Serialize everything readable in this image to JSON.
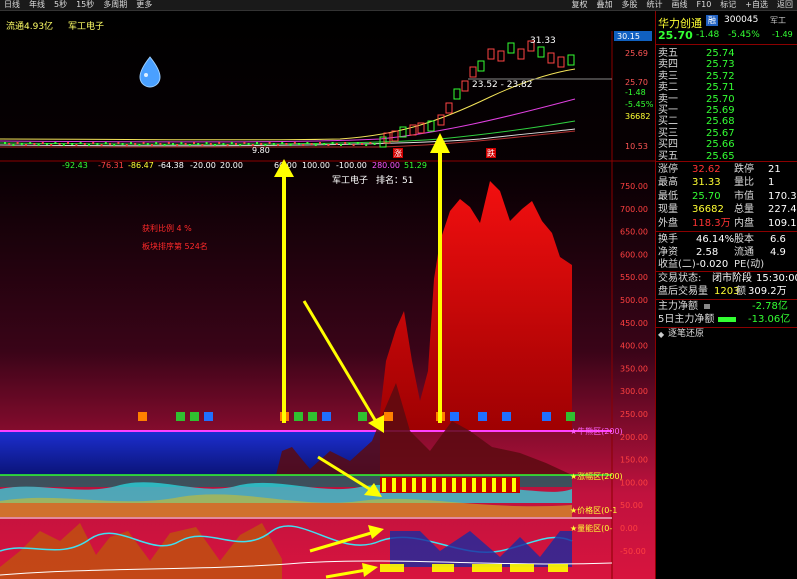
{
  "toolbar": {
    "left_items": [
      "日线",
      "年线",
      "5秒",
      "15秒",
      "多周期",
      "更多"
    ],
    "right_items": [
      "复权",
      "叠加",
      "多股",
      "统计",
      "画线",
      "F10",
      "标记",
      "+自选",
      "返回"
    ]
  },
  "chart_header": {
    "float_text": "流通4.93亿",
    "industry": "军工电子"
  },
  "price_chart": {
    "price_labels": [
      "30.15",
      "25.69",
      "25.70",
      "-1.48",
      "-5.45%",
      "36682",
      "10.53"
    ],
    "annotations": {
      "high": "31.33",
      "range": "23.52 - 23.82",
      "low": "9.80"
    },
    "markers": [
      "涨",
      "跌"
    ]
  },
  "indicator_bar": {
    "values": [
      "-92.43",
      "-76.31",
      "-86.47",
      "-64.38",
      "-20.00",
      "20.00",
      "60.00",
      "100.00",
      "-100.00",
      "280.00",
      "51.29"
    ],
    "sector": "军工电子",
    "rank_label": "排名：",
    "rank_value": "51"
  },
  "lower_chart": {
    "notes": [
      "获利比例 4 %",
      "板块排序第 524名"
    ],
    "y_labels": [
      "750.00",
      "700.00",
      "650.00",
      "600.00",
      "550.00",
      "500.00",
      "450.00",
      "400.00",
      "350.00",
      "300.00",
      "250.00",
      "200.00",
      "150.00",
      "100.00",
      "50.00",
      "0.00",
      "-50.00"
    ],
    "zone_labels": [
      "★牛熊区(200)",
      "★涨幅区(200)",
      "★价格区(0-1",
      "★量能区(0-"
    ]
  },
  "stock": {
    "name": "华力创通",
    "code": "300045",
    "price": "25.70",
    "change": "-1.48",
    "change_pct": "-5.45%",
    "badge": "融",
    "extra_tag": "军工",
    "extra_value": "-1.49"
  },
  "order_book": [
    {
      "label": "卖五",
      "price": "25.74"
    },
    {
      "label": "卖四",
      "price": "25.73"
    },
    {
      "label": "卖三",
      "price": "25.72"
    },
    {
      "label": "卖二",
      "price": "25.71"
    },
    {
      "label": "卖一",
      "price": "25.70"
    },
    {
      "label": "买一",
      "price": "25.69"
    },
    {
      "label": "买二",
      "price": "25.68"
    },
    {
      "label": "买三",
      "price": "25.67"
    },
    {
      "label": "买四",
      "price": "25.66"
    },
    {
      "label": "买五",
      "price": "25.65"
    }
  ],
  "stats": [
    {
      "l1": "涨停",
      "v1": "32.62",
      "l2": "跌停",
      "v2": "21"
    },
    {
      "l1": "最高",
      "v1": "31.33",
      "l2": "量比",
      "v2": "1"
    },
    {
      "l1": "最低",
      "v1": "25.70",
      "l2": "市值",
      "v2": "170.3"
    },
    {
      "l1": "现量",
      "v1": "36682",
      "l2": "总量",
      "v2": "227.4"
    },
    {
      "l1": "外盘",
      "v1": "118.3万",
      "l2": "内盘",
      "v2": "109.1"
    }
  ],
  "stats2": [
    {
      "l1": "换手",
      "v1": "46.14%",
      "l2": "股本",
      "v2": "6.6"
    },
    {
      "l1": "净资",
      "v1": "2.58",
      "l2": "流通",
      "v2": "4.9"
    },
    {
      "l1": "收益(二)",
      "v1": "-0.020",
      "l2": "PE(动)",
      "v2": ""
    }
  ],
  "trade_status": {
    "label": "交易状态:",
    "value": "闭市阶段",
    "time": "15:30:00"
  },
  "after_hours": {
    "label": "盘后交易量",
    "vol": "1203",
    "amount_label": "额",
    "amount": "309.2万"
  },
  "capital_flow": [
    {
      "label": "主力净额",
      "value": "-2.78亿"
    },
    {
      "label": "5日主力净额",
      "value": "-13.06亿"
    }
  ],
  "bottom_tab": "逐笔还原",
  "colors": {
    "up": "#ff3333",
    "down": "#33ff33",
    "accent": "#ffff00",
    "area_red": "#d40000"
  }
}
